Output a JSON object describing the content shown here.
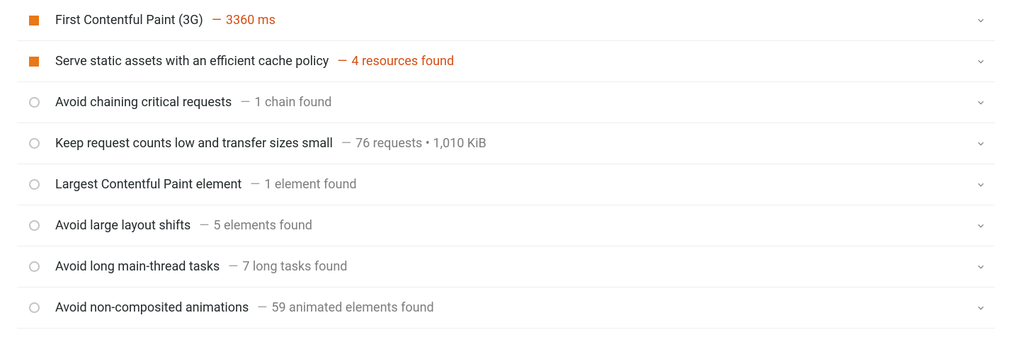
{
  "audits": [
    {
      "status": "warn",
      "title": "First Contentful Paint (3G)",
      "detail": "3360 ms",
      "detail_style": "warn"
    },
    {
      "status": "warn",
      "title": "Serve static assets with an efficient cache policy",
      "detail": "4 resources found",
      "detail_style": "warn"
    },
    {
      "status": "info",
      "title": "Avoid chaining critical requests",
      "detail": "1 chain found",
      "detail_style": "muted"
    },
    {
      "status": "info",
      "title": "Keep request counts low and transfer sizes small",
      "detail": "76 requests • 1,010 KiB",
      "detail_style": "muted"
    },
    {
      "status": "info",
      "title": "Largest Contentful Paint element",
      "detail": "1 element found",
      "detail_style": "muted"
    },
    {
      "status": "info",
      "title": "Avoid large layout shifts",
      "detail": "5 elements found",
      "detail_style": "muted"
    },
    {
      "status": "info",
      "title": "Avoid long main-thread tasks",
      "detail": "7 long tasks found",
      "detail_style": "muted"
    },
    {
      "status": "info",
      "title": "Avoid non-composited animations",
      "detail": "59 animated elements found",
      "detail_style": "muted"
    }
  ]
}
